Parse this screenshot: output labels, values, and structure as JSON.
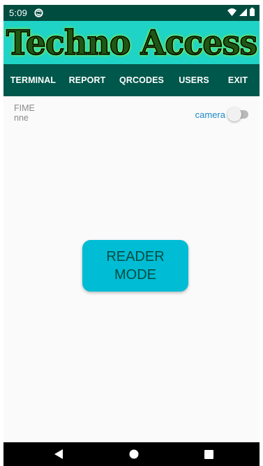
{
  "status_bar": {
    "time": "5:09",
    "icons": [
      "sync-icon",
      "wifi-icon",
      "signal-icon",
      "battery-icon"
    ]
  },
  "banner": {
    "title": "Techno Access"
  },
  "tabs": [
    {
      "label": "TERMINAL",
      "active": true
    },
    {
      "label": "REPORT",
      "active": false
    },
    {
      "label": "QRCODES",
      "active": false
    },
    {
      "label": "USERS",
      "active": false
    },
    {
      "label": "EXIT",
      "active": false
    }
  ],
  "info": {
    "line1": "FIME",
    "line2": "nne"
  },
  "camera": {
    "label": "camera",
    "enabled": false
  },
  "reader_button": {
    "line1": "READER",
    "line2": "MODE"
  },
  "nav": {
    "icons": [
      "back-icon",
      "home-icon",
      "recent-apps-icon"
    ]
  },
  "colors": {
    "status_bar": "#004d40",
    "banner": "#1fd3c6",
    "tab_bar": "#00574b",
    "reader_button": "#00bcd4",
    "camera_label": "#1e88c8"
  }
}
